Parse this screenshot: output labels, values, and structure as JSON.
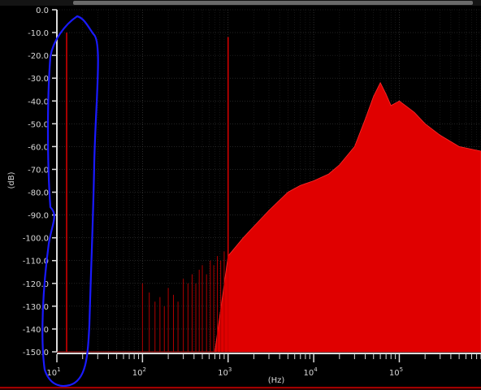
{
  "chart_data": {
    "type": "area",
    "title": "",
    "ylabel": "(dB)",
    "xlabel": "(Hz)",
    "x_scale": "log",
    "xlim": [
      10,
      900000
    ],
    "ylim": [
      -150,
      0
    ],
    "y_ticks": [
      0,
      -10,
      -20,
      -30,
      -40,
      -50,
      -60,
      -70,
      -80,
      -90,
      -100,
      -110,
      -120,
      -130,
      -140,
      -150
    ],
    "y_tick_labels": [
      "0.0",
      "-10.0",
      "-20.0",
      "-30.0",
      "-40.0",
      "-50.0",
      "-60.0",
      "-70.0",
      "-80.0",
      "-90.0",
      "-100.0",
      "-110.0",
      "-120.0",
      "-130.0",
      "-140.0",
      "-150.0"
    ],
    "x_major_ticks": [
      10,
      100,
      1000,
      10000,
      100000
    ],
    "x_tick_labels": [
      {
        "base": "10",
        "exp": "1"
      },
      {
        "base": "10",
        "exp": "2"
      },
      {
        "base": "10",
        "exp": "3"
      },
      {
        "base": "10",
        "exp": "4"
      },
      {
        "base": "10",
        "exp": "5"
      }
    ],
    "grid": true,
    "spectrum_color": "#e00000",
    "series": [
      {
        "x": [
          10,
          13,
          20,
          30,
          50,
          80,
          100,
          150,
          200,
          300,
          500,
          700,
          1000,
          1500,
          2000,
          3000,
          5000,
          7000,
          10000,
          15000,
          20000,
          30000,
          40000,
          50000,
          60000,
          70000,
          80000,
          100000,
          150000,
          200000,
          300000,
          500000,
          900000
        ],
        "y": [
          -150,
          -150,
          -150,
          -150,
          -150,
          -150,
          -150,
          -150,
          -150,
          -150,
          -150,
          -150,
          -108,
          -100,
          -95,
          -88,
          -80,
          -77,
          -75,
          -72,
          -68,
          -60,
          -48,
          -38,
          -32,
          -37,
          -42,
          -40,
          -45,
          -50,
          -55,
          -60,
          -62
        ]
      }
    ],
    "lines": [
      {
        "x": 13,
        "y": -10
      },
      {
        "x": 1000,
        "y": -12
      }
    ],
    "harmonics": [
      {
        "x": 100,
        "y": -120
      },
      {
        "x": 120,
        "y": -124
      },
      {
        "x": 140,
        "y": -128
      },
      {
        "x": 160,
        "y": -126
      },
      {
        "x": 180,
        "y": -130
      },
      {
        "x": 200,
        "y": -122
      },
      {
        "x": 230,
        "y": -125
      },
      {
        "x": 260,
        "y": -128
      },
      {
        "x": 300,
        "y": -118
      },
      {
        "x": 340,
        "y": -120
      },
      {
        "x": 380,
        "y": -116
      },
      {
        "x": 420,
        "y": -120
      },
      {
        "x": 460,
        "y": -114
      },
      {
        "x": 500,
        "y": -112
      },
      {
        "x": 560,
        "y": -116
      },
      {
        "x": 620,
        "y": -110
      },
      {
        "x": 680,
        "y": -112
      },
      {
        "x": 750,
        "y": -108
      },
      {
        "x": 820,
        "y": -110
      },
      {
        "x": 900,
        "y": -106
      }
    ]
  }
}
